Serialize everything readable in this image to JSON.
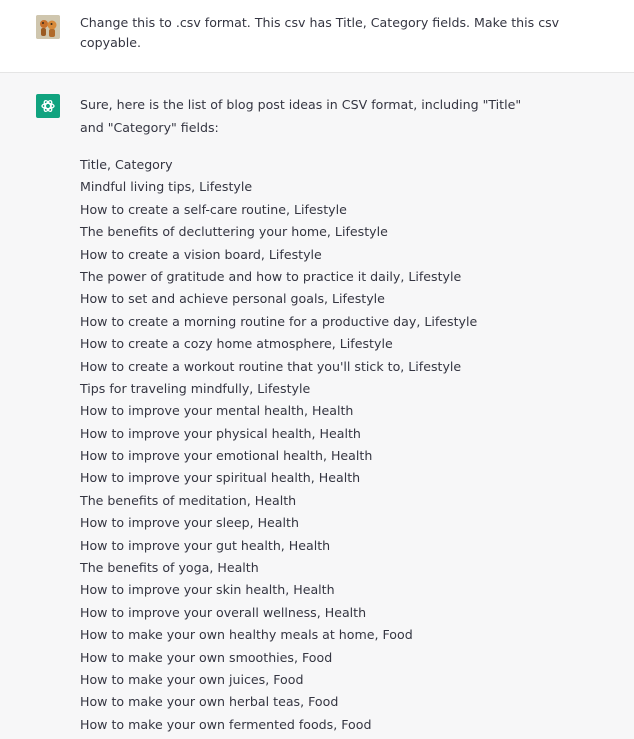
{
  "user_message": {
    "avatar": "user-avatar-image",
    "text": "Change this to .csv format. This csv has Title, Category fields. Make this csv copyable."
  },
  "assistant_message": {
    "avatar": "openai-logo-icon",
    "accent_color": "#10a37f",
    "intro": "Sure, here is the list of blog post ideas in CSV format, including \"Title\" and \"Category\" fields:",
    "lines": [
      "Title, Category",
      "Mindful living tips, Lifestyle",
      "How to create a self-care routine, Lifestyle",
      "The benefits of decluttering your home, Lifestyle",
      "How to create a vision board, Lifestyle",
      "The power of gratitude and how to practice it daily, Lifestyle",
      "How to set and achieve personal goals, Lifestyle",
      "How to create a morning routine for a productive day, Lifestyle",
      "How to create a cozy home atmosphere, Lifestyle",
      "How to create a workout routine that you'll stick to, Lifestyle",
      "Tips for traveling mindfully, Lifestyle",
      "How to improve your mental health, Health",
      "How to improve your physical health, Health",
      "How to improve your emotional health, Health",
      "How to improve your spiritual health, Health",
      "The benefits of meditation, Health",
      "How to improve your sleep, Health",
      "How to improve your gut health, Health",
      "The benefits of yoga, Health",
      "How to improve your skin health, Health",
      "How to improve your overall wellness, Health",
      "How to make your own healthy meals at home, Food",
      "How to make your own smoothies, Food",
      "How to make your own juices, Food",
      "How to make your own herbal teas, Food",
      "How to make your own fermented foods, Food"
    ]
  }
}
